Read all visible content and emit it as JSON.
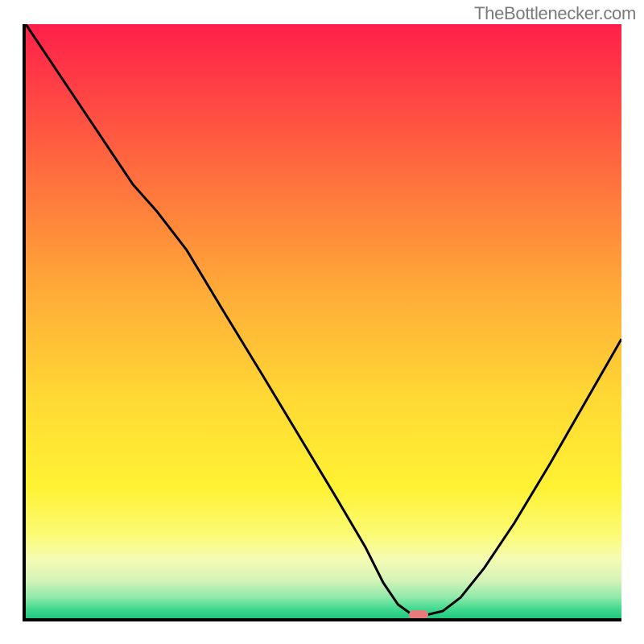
{
  "attribution": "TheBottlenecker.com",
  "gradient_stops": [
    {
      "offset": 0.0,
      "color": "#ff1f4a"
    },
    {
      "offset": 0.1,
      "color": "#ff3e46"
    },
    {
      "offset": 0.25,
      "color": "#ff6d3e"
    },
    {
      "offset": 0.45,
      "color": "#ffab38"
    },
    {
      "offset": 0.63,
      "color": "#ffd934"
    },
    {
      "offset": 0.78,
      "color": "#fff233"
    },
    {
      "offset": 0.86,
      "color": "#fbfb75"
    },
    {
      "offset": 0.9,
      "color": "#f5fbb3"
    },
    {
      "offset": 0.935,
      "color": "#d7f3b8"
    },
    {
      "offset": 0.965,
      "color": "#8fe9aa"
    },
    {
      "offset": 0.985,
      "color": "#3fd98e"
    },
    {
      "offset": 1.0,
      "color": "#1fc97f"
    }
  ],
  "chart_data": {
    "type": "line",
    "title": "",
    "xlabel": "",
    "ylabel": "",
    "xlim": [
      0,
      100
    ],
    "ylim": [
      0,
      100
    ],
    "x": [
      0,
      6,
      12,
      18,
      22,
      27,
      33,
      40,
      46,
      52,
      57,
      60,
      62.5,
      65,
      67,
      70,
      73,
      77,
      82,
      88,
      94,
      100
    ],
    "values": [
      100,
      91,
      82,
      73,
      68.5,
      62,
      52,
      40.5,
      30.5,
      20.5,
      12,
      6,
      2.3,
      0.5,
      0.5,
      1.2,
      3.5,
      8.5,
      16,
      26,
      36.5,
      47
    ],
    "marker": {
      "x": 66,
      "y": 0.5
    },
    "legend": false,
    "grid": false
  },
  "marker_color": "#e77a7a",
  "curve_color": "#000000",
  "curve_width": 3
}
